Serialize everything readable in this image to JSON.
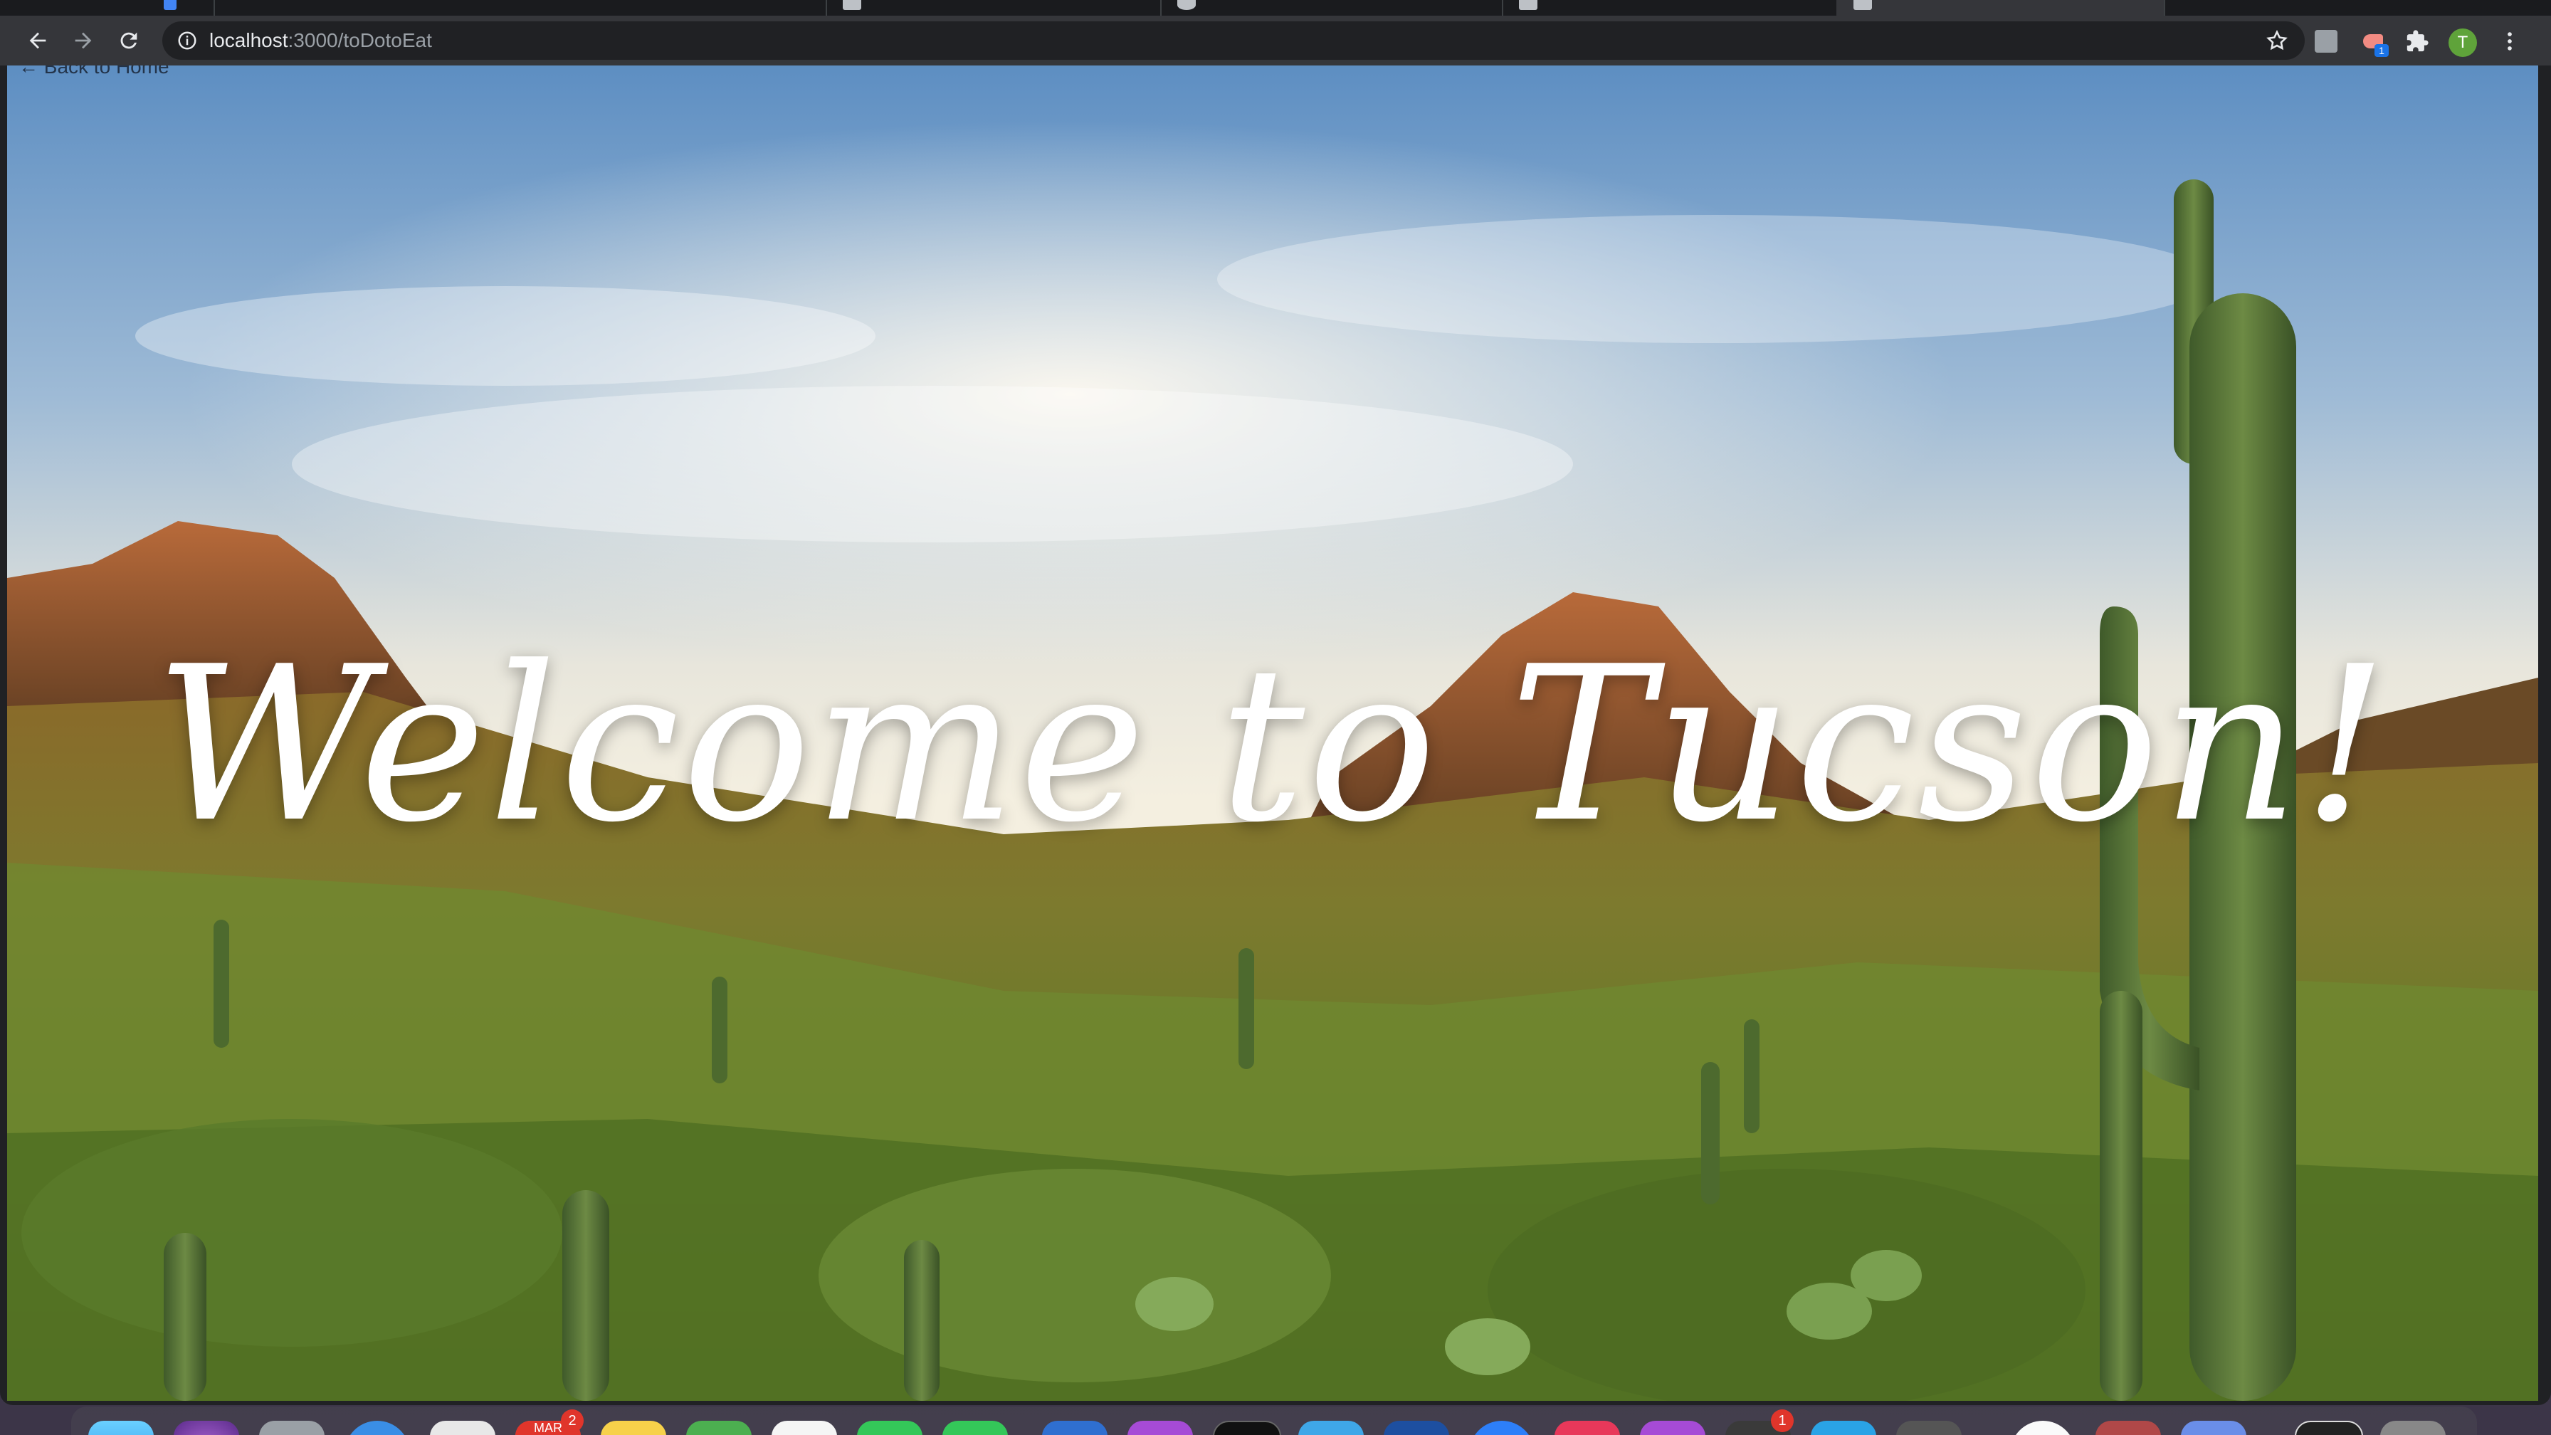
{
  "browser": {
    "url_host": "localhost",
    "url_path": ":3000/toDotoEat",
    "profile_initial": "T",
    "extension_badge": "1",
    "tabs": [
      {
        "active": false
      },
      {
        "active": false
      },
      {
        "active": false
      },
      {
        "active": false
      },
      {
        "active": false
      },
      {
        "active": true
      }
    ],
    "icons": {
      "back": "arrow-left-icon",
      "forward": "arrow-right-icon",
      "reload": "reload-icon",
      "site_info": "info-icon",
      "bookmark": "star-icon",
      "extensions": "puzzle-icon",
      "menu": "kebab-menu-icon"
    }
  },
  "page": {
    "back_link": "← Back to Home",
    "hero_title": "Welcome to Tucson!"
  },
  "dock": {
    "badges": {
      "calendar_app": "2",
      "messages_app": "1"
    },
    "calendar_label": "MAR"
  },
  "colors": {
    "chrome_toolbar": "#35363a",
    "omnibox": "#202124",
    "profile": "#5fa33a",
    "title": "#ffffff"
  }
}
